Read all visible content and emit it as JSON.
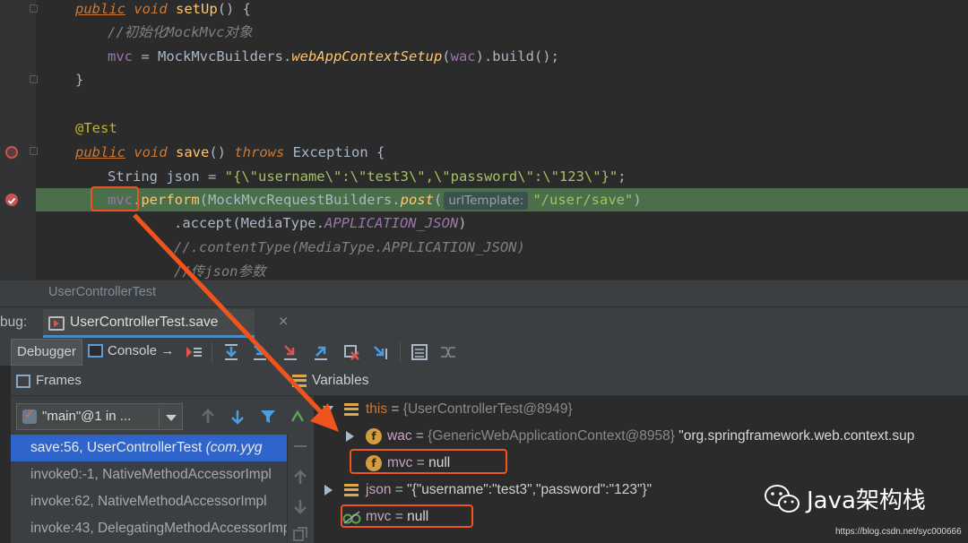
{
  "editor": {
    "lines": {
      "l1": {
        "kw1": "public",
        "kw2": "void",
        "fn": "setUp",
        "rest": "() {"
      },
      "l2": {
        "comment": "//初始化MockMvc对象"
      },
      "l3": {
        "field": "mvc",
        "eq": " = MockMvcBuilders.",
        "method": "webAppContextSetup",
        "open": "(",
        "arg": "wac",
        "rest": ").build();"
      },
      "l4": {
        "text": "}"
      },
      "l6": {
        "annotation": "@Test"
      },
      "l7": {
        "kw1": "public",
        "kw2": "void",
        "fn": "save",
        "mid": "() ",
        "kw3": "throws",
        "rest": " Exception {"
      },
      "l8": {
        "type": "String json = ",
        "string": "\"{\\\"username\\\":\\\"test3\\\",\\\"password\\\":\\\"123\\\"}\"",
        "end": ";"
      },
      "l9": {
        "field": "mvc",
        "dot": ".",
        "method": "perform",
        "mid": "(MockMvcRequestBuilders.",
        "method2": "post",
        "open": "(",
        "hint": "urlTemplate:",
        "string": "\"/user/save\"",
        "close": ")"
      },
      "l10": {
        "text": ".accept(MediaType.",
        "const": "APPLICATION_JSON",
        "close": ")"
      },
      "l11": {
        "comment": "//.contentType(MediaType.APPLICATION_JSON)"
      },
      "l12": {
        "comment": "//传json参数"
      }
    },
    "breadcrumb": "UserControllerTest"
  },
  "debug": {
    "label": "bug:",
    "tab_label": "UserControllerTest.save",
    "tab_close": "×"
  },
  "toolbar": {
    "debugger": "Debugger",
    "console": "Console",
    "console_arrow": "→"
  },
  "frames": {
    "header": "Frames",
    "thread": "\"main\"@1 in ...",
    "rows": [
      {
        "method": "save:56, UserControllerTest ",
        "cls": "(com.yyg"
      },
      {
        "method": "invoke0:-1, NativeMethodAccessorImpl",
        "cls": ""
      },
      {
        "method": "invoke:62, NativeMethodAccessorImpl",
        "cls": ""
      },
      {
        "method": "invoke:43, DelegatingMethodAccessorImpl",
        "cls": ""
      }
    ]
  },
  "variables": {
    "header": "Variables",
    "this": {
      "name": "this",
      "eq": " = ",
      "value": "{UserControllerTest@8949}"
    },
    "wac": {
      "badge": "f",
      "name": "wac",
      "eq": " = ",
      "value": "{GenericWebApplicationContext@8958}",
      "desc": " \"org.springframework.web.context.sup"
    },
    "mvc_field": {
      "badge": "f",
      "name": "mvc",
      "eq": " = ",
      "value": "null"
    },
    "json": {
      "name": "json",
      "eq": " = ",
      "value": "\"{\"username\":\"test3\",\"password\":\"123\"}\""
    },
    "mvc_watch": {
      "name": "mvc",
      "eq": " = ",
      "value": "null"
    }
  },
  "watermark": {
    "text": "Java架构栈",
    "url": "https://blog.csdn.net/syc000666"
  },
  "colors": {
    "annotation": "#f0541d",
    "highlight_line": "#4b6e4b",
    "selection": "#2f65ca"
  }
}
